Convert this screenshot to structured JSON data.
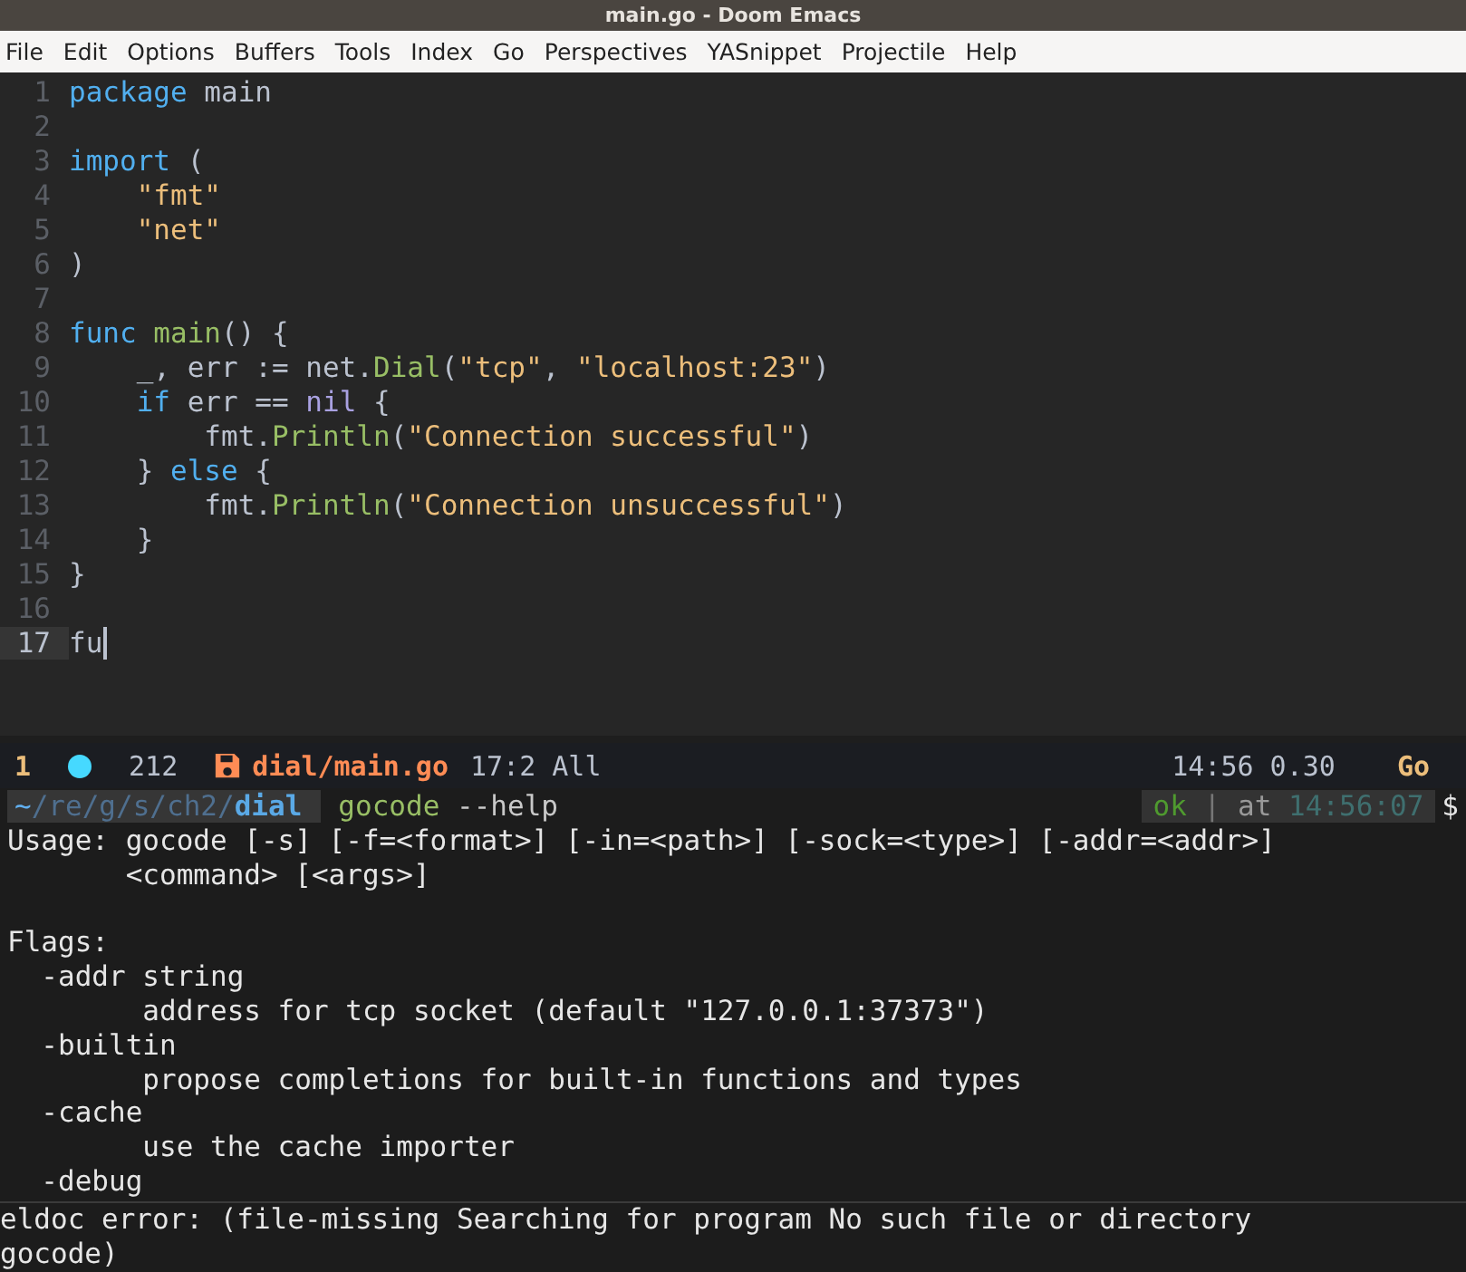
{
  "window": {
    "title": "main.go - Doom Emacs"
  },
  "menu_bar": [
    "File",
    "Edit",
    "Options",
    "Buffers",
    "Tools",
    "Index",
    "Go",
    "Perspectives",
    "YASnippet",
    "Projectile",
    "Help"
  ],
  "editor": {
    "lines": [
      {
        "number": "1",
        "current": false,
        "tokens": [
          {
            "text": "package",
            "kind": "keyword"
          },
          {
            "text": " main",
            "kind": "plain"
          }
        ]
      },
      {
        "number": "2",
        "current": false
      },
      {
        "number": "3",
        "current": false,
        "tokens": [
          {
            "text": "import",
            "kind": "keyword"
          },
          {
            "text": " (",
            "kind": "plain"
          }
        ]
      },
      {
        "number": "4",
        "current": false,
        "tokens": [
          {
            "text": "    \"fmt\"",
            "kind": "string"
          }
        ]
      },
      {
        "number": "5",
        "current": false,
        "tokens": [
          {
            "text": "    \"net\"",
            "kind": "string"
          }
        ]
      },
      {
        "number": "6",
        "current": false,
        "tokens": [
          {
            "text": ")",
            "kind": "plain"
          }
        ]
      },
      {
        "number": "7",
        "current": false
      },
      {
        "number": "8",
        "current": false,
        "tokens": [
          {
            "text": "func",
            "kind": "keyword"
          },
          {
            "text": " main",
            "kind": "function"
          },
          {
            "text": "() {",
            "kind": "plain"
          }
        ]
      },
      {
        "number": "9",
        "current": false,
        "tokens": [
          {
            "text": "    _, err := net.",
            "kind": "plain"
          },
          {
            "text": "Dial",
            "kind": "function"
          },
          {
            "text": "(",
            "kind": "plain"
          },
          {
            "text": "\"tcp\"",
            "kind": "string"
          },
          {
            "text": ", ",
            "kind": "plain"
          },
          {
            "text": "\"localhost:23\"",
            "kind": "string"
          },
          {
            "text": ")",
            "kind": "plain"
          }
        ]
      },
      {
        "number": "10",
        "current": false,
        "tokens": [
          {
            "text": "    if",
            "kind": "keyword"
          },
          {
            "text": " err == ",
            "kind": "plain"
          },
          {
            "text": "nil",
            "kind": "constant"
          },
          {
            "text": " {",
            "kind": "plain"
          }
        ]
      },
      {
        "number": "11",
        "current": false,
        "tokens": [
          {
            "text": "        fmt.",
            "kind": "plain"
          },
          {
            "text": "Println",
            "kind": "function"
          },
          {
            "text": "(",
            "kind": "plain"
          },
          {
            "text": "\"Connection successful\"",
            "kind": "string"
          },
          {
            "text": ")",
            "kind": "plain"
          }
        ]
      },
      {
        "number": "12",
        "current": false,
        "tokens": [
          {
            "text": "    } ",
            "kind": "plain"
          },
          {
            "text": "else",
            "kind": "keyword"
          },
          {
            "text": " {",
            "kind": "plain"
          }
        ]
      },
      {
        "number": "13",
        "current": false,
        "tokens": [
          {
            "text": "        fmt.",
            "kind": "plain"
          },
          {
            "text": "Println",
            "kind": "function"
          },
          {
            "text": "(",
            "kind": "plain"
          },
          {
            "text": "\"Connection unsuccessful\"",
            "kind": "string"
          },
          {
            "text": ")",
            "kind": "plain"
          }
        ]
      },
      {
        "number": "14",
        "current": false,
        "tokens": [
          {
            "text": "    }",
            "kind": "plain"
          }
        ]
      },
      {
        "number": "15",
        "current": false,
        "tokens": [
          {
            "text": "}",
            "kind": "plain"
          }
        ]
      },
      {
        "number": "16",
        "current": false
      },
      {
        "number": "17",
        "current": true,
        "tokens": [
          {
            "text": "fu",
            "kind": "plain"
          }
        ]
      }
    ]
  },
  "mode_line": {
    "workspace": "1",
    "count": "212",
    "file": "dial/main.go",
    "position": "17:2 All",
    "time_load": "14:56 0.30",
    "major_mode": "Go"
  },
  "prompt": {
    "home": "~",
    "path": "/re/g/s/ch2/",
    "directory": "dial",
    "command": "gocode",
    "arguments": " --help",
    "status": "ok",
    "separator": "|",
    "at": "at",
    "time": "14:56:07",
    "symbol": "$"
  },
  "terminal_output": {
    "usage": [
      "Usage: gocode [-s] [-f=<format>] [-in=<path>] [-sock=<type>] [-addr=<addr>]",
      "       <command> [<args>]"
    ],
    "flags": [
      "Flags:",
      "  -addr string",
      "        address for tcp socket (default \"127.0.0.1:37373\")",
      "  -builtin",
      "        propose completions for built-in functions and types",
      "  -cache",
      "        use the cache importer",
      "  -debug"
    ]
  },
  "echo_area": [
    "eldoc error: (file-missing Searching for program No such file or directory",
    "gocode)"
  ]
}
